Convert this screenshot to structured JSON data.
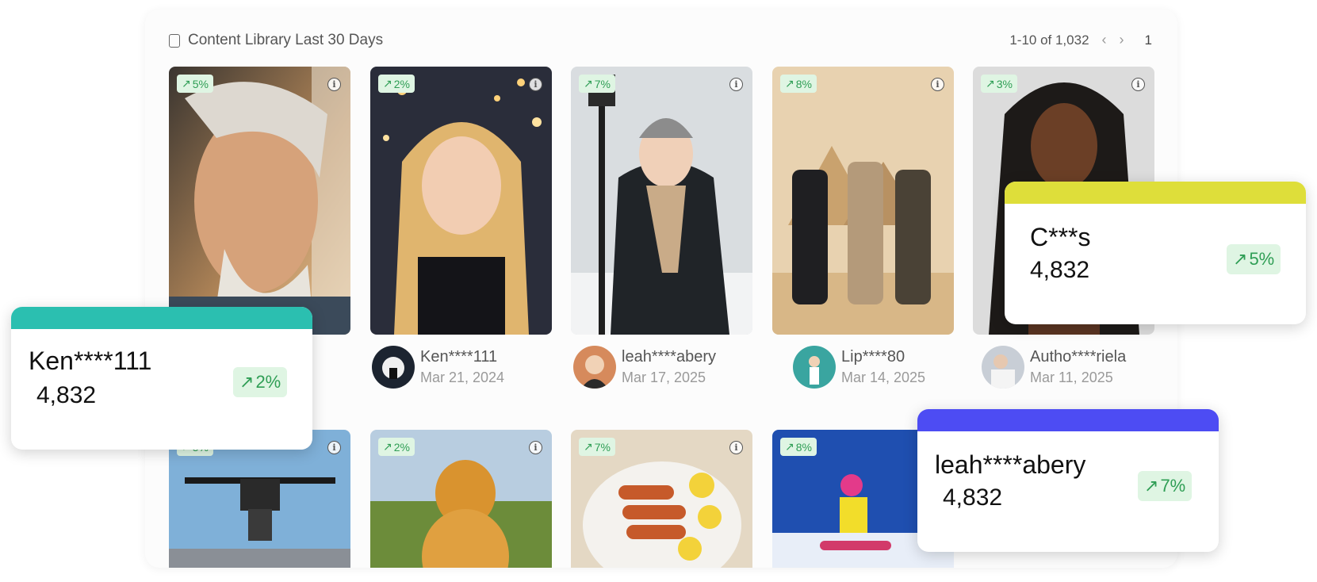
{
  "header": {
    "title": "Content Library Last 30 Days",
    "range": "1-10 of 1,032",
    "page": "1"
  },
  "cards_row1": [
    {
      "trend": "5%"
    },
    {
      "trend": "2%"
    },
    {
      "trend": "7%"
    },
    {
      "trend": "8%"
    },
    {
      "trend": "3%"
    }
  ],
  "authors": [
    {
      "name": "Ken****111",
      "date": "Mar 21, 2024"
    },
    {
      "name": "leah****abery",
      "date": "Mar 17, 2025"
    },
    {
      "name": "Lip****80",
      "date": "Mar 14, 2025"
    },
    {
      "name": "Autho****riela",
      "date": "Mar 11, 2025"
    }
  ],
  "cards_row2": [
    {
      "trend": "5%"
    },
    {
      "trend": "2%"
    },
    {
      "trend": "7%"
    },
    {
      "trend": "8%"
    }
  ],
  "popups": [
    {
      "name": "Ken****111",
      "value": "4,832",
      "trend": "2%",
      "color": "#2bbfb0"
    },
    {
      "name": "C***s",
      "value": "4,832",
      "trend": "5%",
      "color": "#dede3a"
    },
    {
      "name": "leah****abery",
      "value": "4,832",
      "trend": "7%",
      "color": "#4d4cf3"
    }
  ],
  "colors": {
    "trend_bg": "#dff5e3",
    "trend_fg": "#2f9e55"
  },
  "icons": {
    "trend": "trending-up-icon",
    "info": "info-icon",
    "doc": "document-icon"
  }
}
